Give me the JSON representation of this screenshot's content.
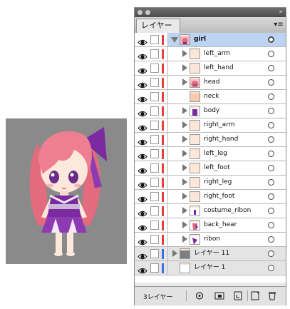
{
  "panel": {
    "tab_label": "レイヤー",
    "footer_count": "3レイヤー",
    "layers": [
      {
        "name": "girl",
        "expanded": true,
        "selected": true,
        "indent": 0,
        "color": "#e8403a",
        "thumb": "girl",
        "has_arrow": true
      },
      {
        "name": "left_arm",
        "indent": 1,
        "color": "#e8403a",
        "thumb": "blank",
        "has_arrow": true
      },
      {
        "name": "left_hand",
        "indent": 1,
        "color": "#e8403a",
        "thumb": "blank",
        "has_arrow": true
      },
      {
        "name": "head",
        "indent": 1,
        "color": "#e8403a",
        "thumb": "head",
        "has_arrow": true
      },
      {
        "name": "neck",
        "indent": 1,
        "color": "#e8403a",
        "thumb": "neck",
        "has_arrow": false
      },
      {
        "name": "body",
        "indent": 1,
        "color": "#e8403a",
        "thumb": "body",
        "has_arrow": true
      },
      {
        "name": "right_arm",
        "indent": 1,
        "color": "#e8403a",
        "thumb": "blank",
        "has_arrow": true
      },
      {
        "name": "right_hand",
        "indent": 1,
        "color": "#e8403a",
        "thumb": "blank",
        "has_arrow": true
      },
      {
        "name": "left_leg",
        "indent": 1,
        "color": "#e8403a",
        "thumb": "blank",
        "has_arrow": true
      },
      {
        "name": "left_foot",
        "indent": 1,
        "color": "#e8403a",
        "thumb": "blank",
        "has_arrow": true
      },
      {
        "name": "right_leg",
        "indent": 1,
        "color": "#e8403a",
        "thumb": "blank",
        "has_arrow": true
      },
      {
        "name": "right_foot",
        "indent": 1,
        "color": "#e8403a",
        "thumb": "blank",
        "has_arrow": true
      },
      {
        "name": "costume_ribon",
        "indent": 1,
        "color": "#e8403a",
        "thumb": "ribon_small",
        "has_arrow": true
      },
      {
        "name": "back_hear",
        "indent": 1,
        "color": "#e8403a",
        "thumb": "hair",
        "has_arrow": true
      },
      {
        "name": "ribon",
        "indent": 1,
        "color": "#e8403a",
        "thumb": "ribon",
        "has_arrow": true
      },
      {
        "name": "レイヤー 11",
        "indent": 0,
        "color": "#3c6fe0",
        "thumb": "gray",
        "has_arrow": true,
        "top_level": true
      },
      {
        "name": "レイヤー 1",
        "indent": 0,
        "color": "#3c6fe0",
        "thumb": "white",
        "has_arrow": false,
        "top_level": true
      }
    ]
  },
  "icons": {
    "eye": "eye-icon",
    "panel_menu": "panel-menu-icon",
    "footer": [
      "locate-object-icon",
      "make-clipping-mask-icon",
      "new-sublayer-icon",
      "new-layer-icon",
      "delete-layer-icon"
    ]
  }
}
